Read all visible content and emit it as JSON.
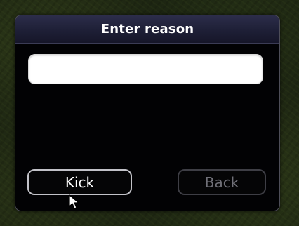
{
  "dialog": {
    "title": "Enter reason",
    "reason_input": {
      "value": "",
      "placeholder": ""
    },
    "buttons": {
      "kick_label": "Kick",
      "back_label": "Back"
    }
  },
  "icons": {
    "cursor": "mouse-pointer-icon"
  },
  "colors": {
    "dialog_background": "#020204",
    "titlebar": "#1e1f36",
    "input_background": "#ffffff",
    "kick_border": "#c2c2c8",
    "back_text_disabled": "#707078"
  }
}
